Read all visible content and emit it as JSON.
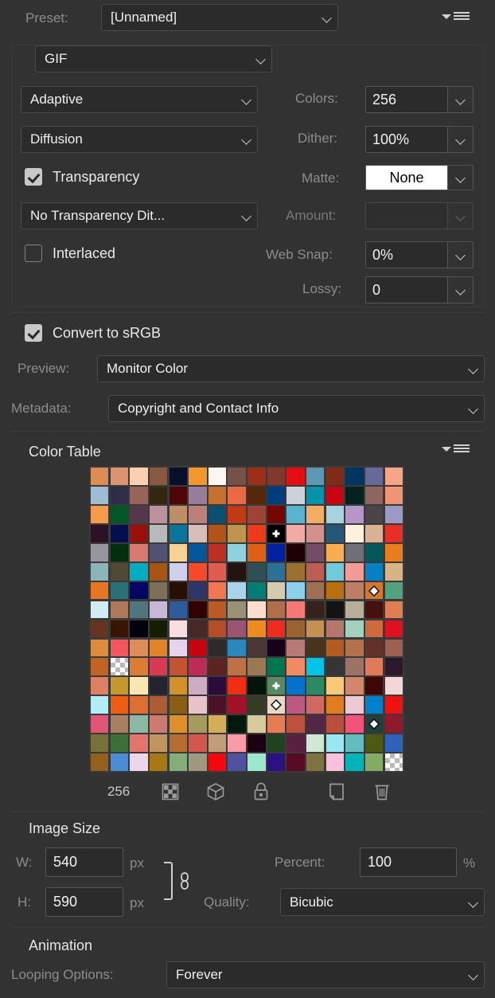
{
  "panel": {
    "preset_label": "Preset:",
    "preset_value": "[Unnamed]",
    "format_value": "GIF",
    "reduction_value": "Adaptive",
    "colors_label": "Colors:",
    "colors_value": "256",
    "dither_algo_value": "Diffusion",
    "dither_label": "Dither:",
    "dither_value": "100%",
    "transparency_label": "Transparency",
    "matte_label": "Matte:",
    "matte_value": "None",
    "transparency_dither_value": "No Transparency Dit...",
    "amount_label": "Amount:",
    "amount_value": "",
    "interlaced_label": "Interlaced",
    "websnap_label": "Web Snap:",
    "websnap_value": "0%",
    "lossy_label": "Lossy:",
    "lossy_value": "0",
    "convert_srgb_label": "Convert to sRGB",
    "preview_label": "Preview:",
    "preview_value": "Monitor Color",
    "metadata_label": "Metadata:",
    "metadata_value": "Copyright and Contact Info"
  },
  "color_table": {
    "title": "Color Table",
    "count": "256",
    "toolbar": [
      {
        "name": "map-to-transparent-button",
        "icon": "checkerboard-icon"
      },
      {
        "name": "map-to-websafe-button",
        "icon": "cube-icon"
      },
      {
        "name": "lock-color-button",
        "icon": "lock-icon"
      },
      {
        "name": "new-color-button",
        "icon": "new-page-icon"
      },
      {
        "name": "delete-color-button",
        "icon": "trash-icon"
      }
    ],
    "columns": 16,
    "swatches": [
      "#dd8d54",
      "#dd9271",
      "#fad0ae",
      "#8a5741",
      "#070f2a",
      "#f2982a",
      "#fcf6f2",
      "#77504a",
      "#9c2f17",
      "#81382d",
      "#e40e13",
      "#5c97b4",
      "#7e2c13",
      "#00365e",
      "#66699a",
      "#f6a485",
      "#9fbcd6",
      "#2e2e4a",
      "#9b6257",
      "#33280f",
      "#4e0707",
      "#987c9b",
      "#c4702f",
      "#e96b45",
      "#572808",
      "#003c7e",
      "#cdd1d8",
      "#0393a9",
      "#c90513",
      "#032321",
      "#90655f",
      "#ef9573",
      "#f59b4b",
      "#035726",
      "#543849",
      "#bb929c",
      "#bf8d66",
      "#bb8078",
      "#0c4f6f",
      "#bf3a15",
      "#9e4336",
      "#740704",
      "#5bb4cf",
      "#f3ac63",
      "#a8d2e0",
      "#b297c7",
      "#4d4348",
      "#9c9ac4",
      "#2c1224",
      "#030f4e",
      "#981009",
      "#b9b9bb",
      "#0a749a",
      "#d9bdba",
      "#b25418",
      "#c0944f",
      "#ee3a19",
      "#000000",
      "#f3aaa4",
      "#d3918d",
      "#255778",
      "#fdf1dd",
      "#dbb194",
      "#e62f27",
      "#97969e",
      "#022f0d",
      "#d97a6c",
      "#515174",
      "#f7d293",
      "#03589c",
      "#bb2f24",
      "#8fd2dd",
      "#e06013",
      "#0121a1",
      "#1c0201",
      "#734c66",
      "#f8ae4e",
      "#706f75",
      "#02585a",
      "#ea7c20",
      "#8cb5b9",
      "#504a35",
      "#03acc0",
      "#a85412",
      "#cfd1ec",
      "#f6482b",
      "#e05b51",
      "#231412",
      "#2f4f54",
      "#2b7097",
      "#9c7030",
      "#bd5e54",
      "#71cada",
      "#f19a96",
      "#0380c6",
      "#d8b482",
      "#e67720",
      "#2a7077",
      "#010564",
      "#7d7057",
      "#241104",
      "#2e3567",
      "#f2764f",
      "#a9d5ec",
      "#027d74",
      "#d4cbb0",
      "#8bd1ec",
      "#a06e53",
      "#b8700f",
      "#bd7f64",
      "#d9762d",
      "#53a27d",
      "#d2ecf3",
      "#b0785a",
      "#527580",
      "#c6b9d7",
      "#2d5b9e",
      "#330101",
      "#bb5a26",
      "#9a9075",
      "#fcdecd",
      "#b26e4b",
      "#f47878",
      "#35211d",
      "#131313",
      "#b6af99",
      "#46100e",
      "#e07e53",
      "#663522",
      "#3a1501",
      "#02020f",
      "#171d02",
      "#f8dee0",
      "#482827",
      "#b64d29",
      "#9b5570",
      "#ee8b1c",
      "#ef2c20",
      "#9b6232",
      "#c29154",
      "#b5776b",
      "#a2d2bd",
      "#d06a3d",
      "#e01022",
      "#db8c3e",
      "#f1575c",
      "#dc8d58",
      "#e0842b",
      "#e6d4ec",
      "#c6050f",
      "#2b2b2b",
      "#2d87bc",
      "#4b3836",
      "#16021a",
      "#b87b73",
      "#47341a",
      "#b35c21",
      "#b4714e",
      "#63312a",
      "#9d6050",
      "#bf6424",
      "",
      "#dd7c34",
      "#d83954",
      "#c55333",
      "#be2b54",
      "#5c241f",
      "#c07045",
      "#9b7854",
      "#01764f",
      "#ed8c63",
      "#03c3e8",
      "#353535",
      "#9c7365",
      "#e07a57",
      "#2a1a2b",
      "#dd8064",
      "#c5972c",
      "#f8e7b0",
      "#262330",
      "#d2922a",
      "#ceabc2",
      "#2b0b3c",
      "#f12d12",
      "#021508",
      "#558a62",
      "#0173cb",
      "#2c8a63",
      "#f8c977",
      "#d2876b",
      "#3f0605",
      "#f3d6d8",
      "#b4ecf4",
      "#ee5e12",
      "#dd6e34",
      "#ad5c36",
      "#8b5e14",
      "#e9c2cb",
      "#4c1027",
      "#a51227",
      "#363b23",
      "#e7d9c4",
      "#bb5a7f",
      "#d0695f",
      "#e27d1f",
      "#eec9d2",
      "#0380cc",
      "#ec1310",
      "#e15577",
      "#a98060",
      "#8cb9a6",
      "#cd7a72",
      "#dd8f29",
      "#a69a5e",
      "#d4ad58",
      "#02180a",
      "#d7cb9a",
      "#e57c54",
      "#bd5140",
      "#512743",
      "#bb4f3c",
      "#f2527c",
      "#20403a",
      "#8f1a2c",
      "#787138",
      "#3b7135",
      "#e3756c",
      "#c1955f",
      "#b76c31",
      "#d5564e",
      "#c29d7a",
      "#f89ba6",
      "#1b0111",
      "#20431f",
      "#592140",
      "#cfe8d4",
      "#9ae7f4",
      "#62bcc0",
      "#4f5914",
      "#2f62bb",
      "#93601d",
      "#4a8dd4",
      "#edd6ea",
      "#a97815",
      "#83ae77",
      "#9e9a82",
      "#f4080e",
      "#51529e",
      "#9ee7cf",
      "#2c1184",
      "#5a0b24",
      "#7d7442",
      "#f8c0da",
      "#02b4b8",
      "#83ad65",
      ""
    ],
    "markers": [
      {
        "index": 57,
        "type": "plus"
      },
      {
        "index": 110,
        "type": "diamond"
      },
      {
        "index": 185,
        "type": "plus"
      },
      {
        "index": 201,
        "type": "diamond"
      },
      {
        "index": 222,
        "type": "diamond"
      },
      {
        "index": 255,
        "type": "checker"
      },
      {
        "index": 161,
        "type": "checker_hidden"
      }
    ]
  },
  "image_size": {
    "title": "Image Size",
    "w_label": "W:",
    "w_value": "540",
    "w_unit": "px",
    "h_label": "H:",
    "h_value": "590",
    "h_unit": "px",
    "percent_label": "Percent:",
    "percent_value": "100",
    "percent_unit": "%",
    "quality_label": "Quality:",
    "quality_value": "Bicubic",
    "link_icon": "chain-link-icon"
  },
  "animation": {
    "title": "Animation",
    "looping_label": "Looping Options:",
    "looping_value": "Forever"
  }
}
